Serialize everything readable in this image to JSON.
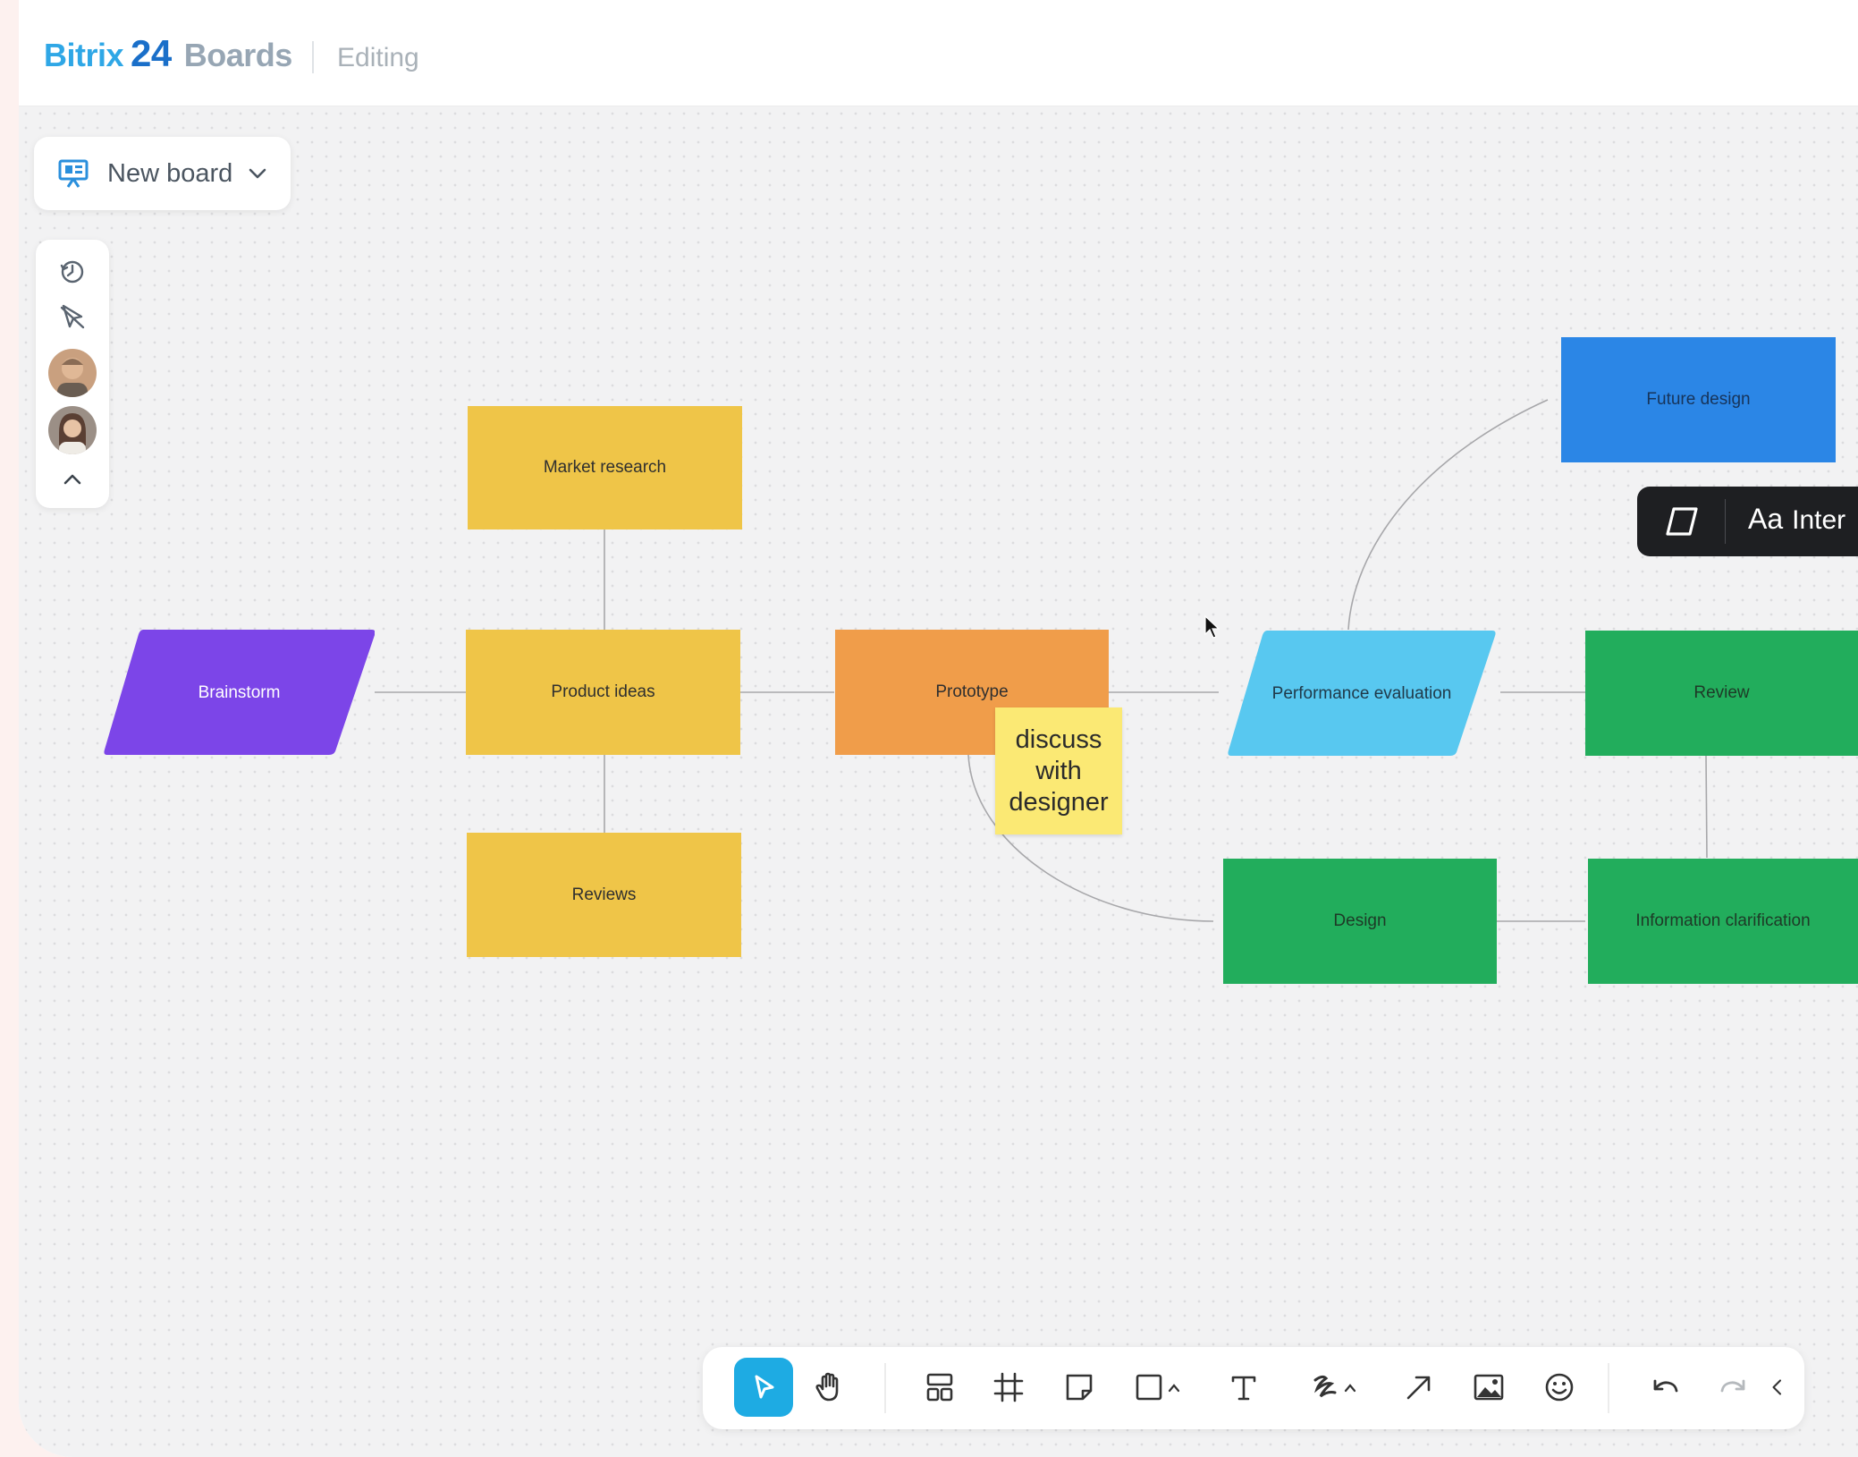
{
  "header": {
    "brand_part1": "Bitrix",
    "brand_part2": "24",
    "brand_part3": "Boards",
    "status": "Editing"
  },
  "board_selector": {
    "label": "New board"
  },
  "nodes": {
    "brainstorm": "Brainstorm",
    "market_research": "Market research",
    "product_ideas": "Product ideas",
    "reviews": "Reviews",
    "prototype": "Prototype",
    "performance_evaluation": "Performance evaluation",
    "future_design": "Future design",
    "review": "Review",
    "design": "Design",
    "information_clarification": "Information clarification"
  },
  "sticky_note": {
    "text": "discuss with designer"
  },
  "text_toolbar": {
    "font_icon": "Aa",
    "font_name": "Inter"
  },
  "bottom_toolbar": {
    "tools": [
      "select-tool",
      "hand-tool",
      "templates-tool",
      "frame-tool",
      "sticky-note-tool",
      "shape-tool",
      "text-tool",
      "pen-tool",
      "connector-tool",
      "image-tool",
      "emoji-tool",
      "undo",
      "redo",
      "collapse"
    ],
    "active_tool": "select-tool"
  },
  "colors": {
    "accent": "#1eabe3",
    "yellow": "#efc548",
    "orange": "#f09d4a",
    "purple": "#7c45e8",
    "cyan": "#58c8f0",
    "green": "#22ad5c",
    "blue": "#2b86e6",
    "sticky": "#fbe974"
  }
}
